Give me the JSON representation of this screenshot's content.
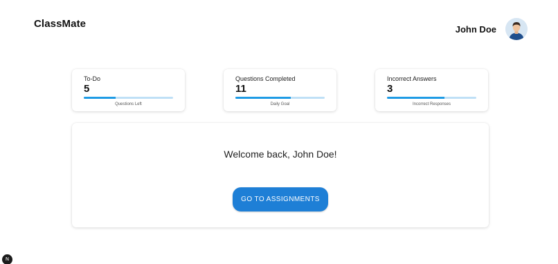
{
  "app": {
    "brand": "ClassMate"
  },
  "user": {
    "name": "John Doe",
    "avatar_icon": "user-avatar-icon"
  },
  "stats": [
    {
      "label": "To-Do",
      "value": "5",
      "caption": "Questions Left",
      "progress": 0.36
    },
    {
      "label": "Questions Completed",
      "value": "11",
      "caption": "Daily Goal",
      "progress": 0.62
    },
    {
      "label": "Incorrect Answers",
      "value": "3",
      "caption": "Incorrect Responses",
      "progress": 0.64
    }
  ],
  "welcome": {
    "message": "Welcome back, John Doe!",
    "cta_label": "GO TO ASSIGNMENTS"
  },
  "devtools": {
    "badge_letter": "N"
  },
  "colors": {
    "accent": "#1e7fd6",
    "progress_fill": "#1e9be5",
    "progress_track": "#bfe0f6"
  }
}
